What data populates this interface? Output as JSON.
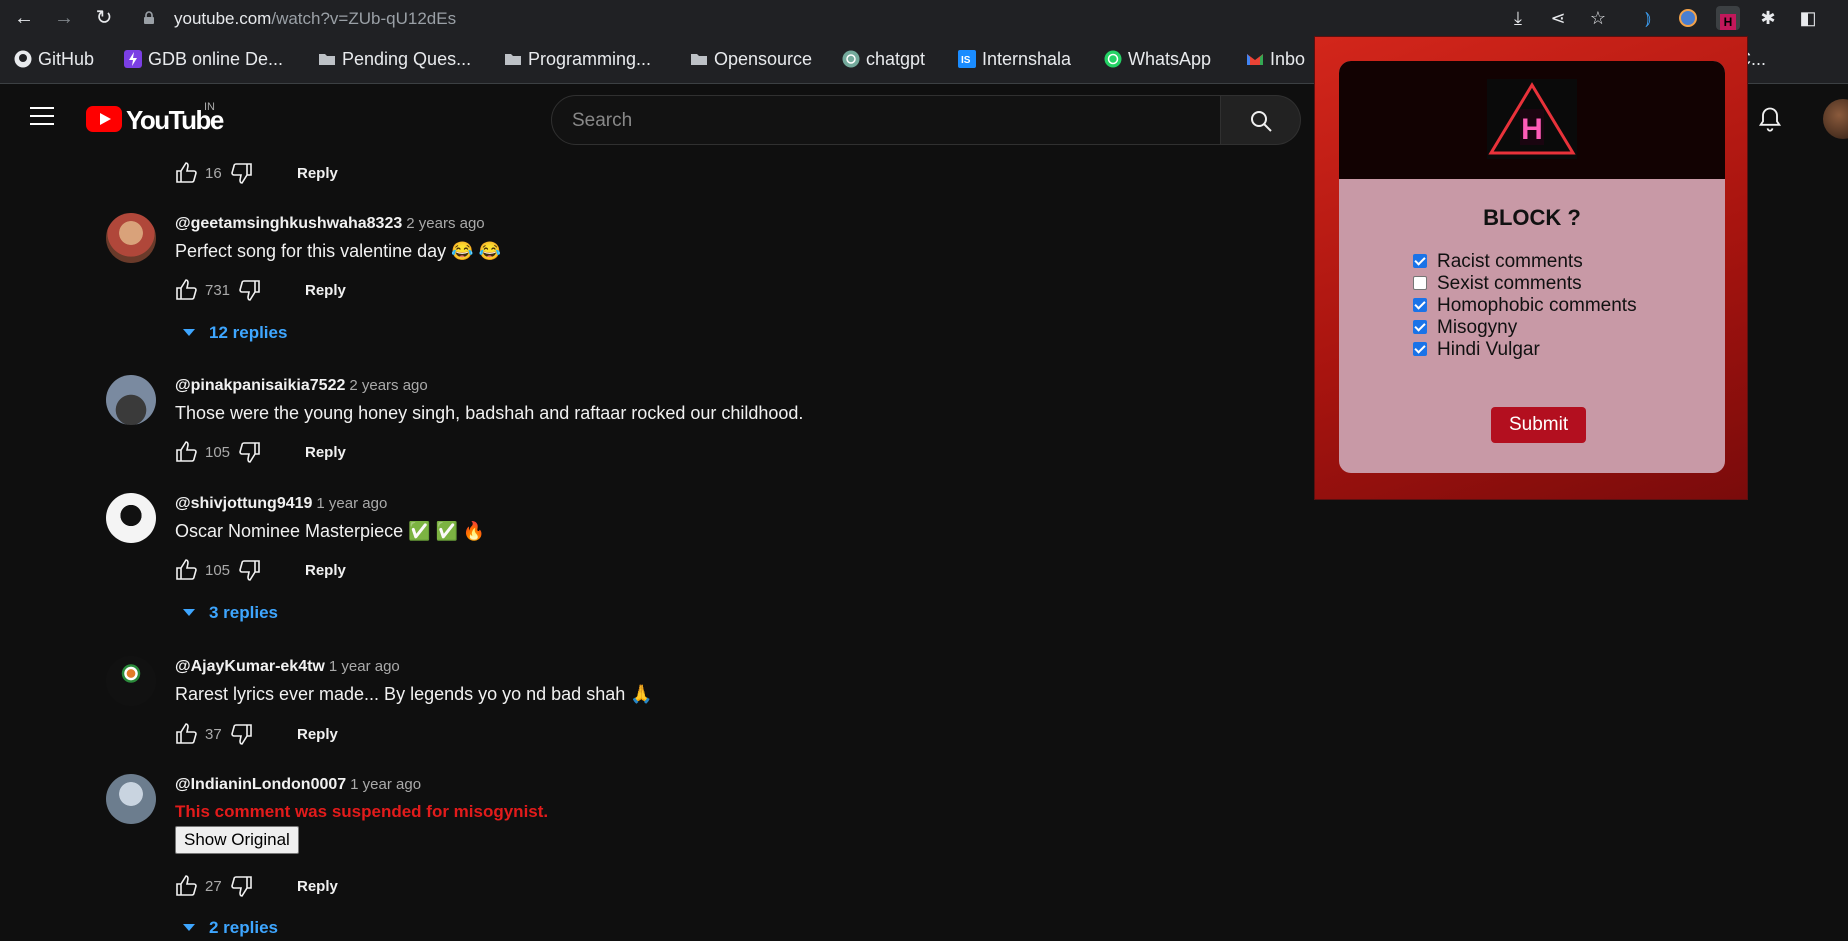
{
  "browser": {
    "url_host": "youtube.com",
    "url_path": "/watch?v=ZUb-qU12dEs",
    "bookmarks": [
      {
        "label": "GitHub",
        "icon": "github-icon"
      },
      {
        "label": "GDB online De...",
        "icon": "gdb-icon"
      },
      {
        "label": "Pending Ques...",
        "icon": "folder-icon"
      },
      {
        "label": "Programming...",
        "icon": "folder-icon"
      },
      {
        "label": "Opensource",
        "icon": "folder-icon"
      },
      {
        "label": "chatgpt",
        "icon": "chatgpt-icon"
      },
      {
        "label": "Internshala",
        "icon": "internshala-icon"
      },
      {
        "label": "WhatsApp",
        "icon": "whatsapp-icon"
      },
      {
        "label": "Inbo",
        "icon": "gmail-icon"
      },
      {
        "label": "C...",
        "icon": "bookmark-icon"
      }
    ]
  },
  "youtube": {
    "logo_text": "YouTube",
    "country_code": "IN",
    "search_placeholder": "Search"
  },
  "comments": {
    "top_actions": {
      "likes": "16",
      "reply_label": "Reply"
    },
    "items": [
      {
        "author": "@geetamsinghkushwaha8323",
        "ago": "2 years ago",
        "text": "Perfect song for this valentine day 😂 😂",
        "likes": "731",
        "reply_label": "Reply",
        "replies": "12 replies"
      },
      {
        "author": "@pinakpanisaikia7522",
        "ago": "2 years ago",
        "text": "Those were the young honey singh, badshah and raftaar rocked our childhood.",
        "likes": "105",
        "reply_label": "Reply"
      },
      {
        "author": "@shivjottung9419",
        "ago": "1 year ago",
        "text": "Oscar Nominee Masterpiece ✅ ✅ 🔥",
        "likes": "105",
        "reply_label": "Reply",
        "replies": "3 replies"
      },
      {
        "author": "@AjayKumar-ek4tw",
        "ago": "1 year ago",
        "text": "Rarest lyrics ever made... By legends yo yo nd bad shah 🙏",
        "likes": "37",
        "reply_label": "Reply"
      },
      {
        "author": "@IndianinLondon0007",
        "ago": "1 year ago",
        "suspended": "This comment was suspended for misogynist.",
        "show_original": "Show Original",
        "likes": "27",
        "reply_label": "Reply",
        "replies": "2 replies"
      }
    ]
  },
  "extension_popup": {
    "logo_letter": "H",
    "title": "BLOCK ?",
    "options": [
      {
        "label": "Racist comments",
        "checked": true
      },
      {
        "label": "Sexist comments",
        "checked": false
      },
      {
        "label": "Homophobic comments",
        "checked": true
      },
      {
        "label": "Misogyny",
        "checked": true
      },
      {
        "label": "Hindi Vulgar",
        "checked": true
      }
    ],
    "submit_label": "Submit"
  },
  "colors": {
    "page_bg": "#0f0f0f",
    "link_blue": "#3ea6ff",
    "suspended_red": "#e21b1b",
    "popup_red": "#c41e16",
    "submit_red": "#b30f1f"
  }
}
